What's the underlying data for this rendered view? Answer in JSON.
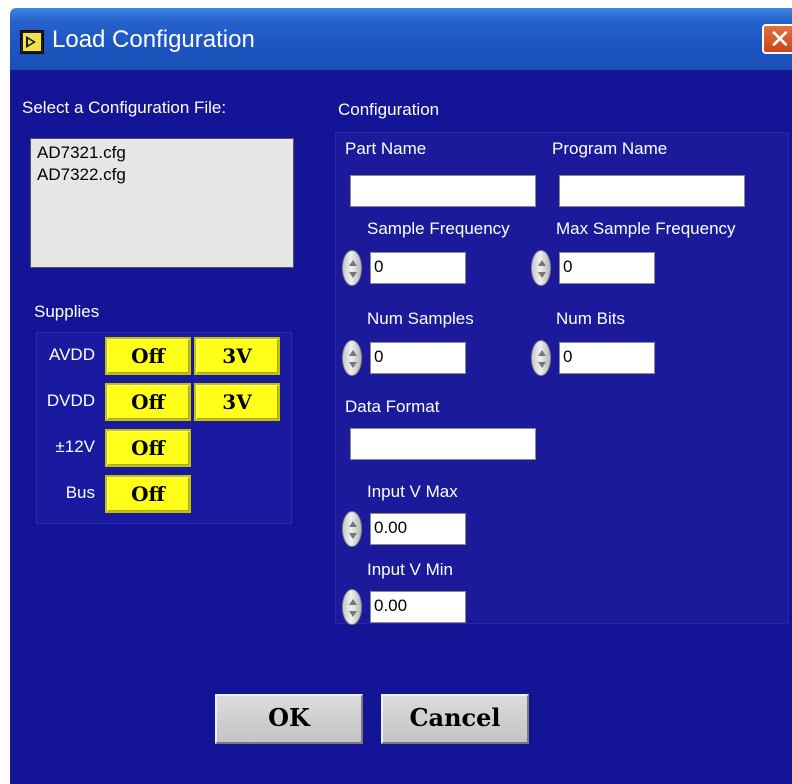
{
  "window": {
    "title": "Load Configuration",
    "close_glyph": "✕"
  },
  "file_select": {
    "label": "Select a Configuration File:",
    "files": [
      "AD7321.cfg",
      "AD7322.cfg"
    ]
  },
  "supplies": {
    "label": "Supplies",
    "rows": [
      {
        "name": "AVDD",
        "state": "Off",
        "voltage": "3V"
      },
      {
        "name": "DVDD",
        "state": "Off",
        "voltage": "3V"
      },
      {
        "name": "±12V",
        "state": "Off"
      },
      {
        "name": "Bus",
        "state": "Off"
      }
    ],
    "button_color": "#ffff19"
  },
  "config": {
    "label": "Configuration",
    "part_name": {
      "label": "Part Name",
      "value": ""
    },
    "program_name": {
      "label": "Program Name",
      "value": ""
    },
    "sample_frequency": {
      "label": "Sample Frequency",
      "value": "0"
    },
    "max_sample_frequency": {
      "label": "Max Sample Frequency",
      "value": "0"
    },
    "num_samples": {
      "label": "Num Samples",
      "value": "0"
    },
    "num_bits": {
      "label": "Num Bits",
      "value": "0"
    },
    "data_format": {
      "label": "Data Format",
      "value": ""
    },
    "input_v_max": {
      "label": "Input V Max",
      "value": "0.00"
    },
    "input_v_min": {
      "label": "Input V Min",
      "value": "0.00"
    }
  },
  "buttons": {
    "ok": "OK",
    "cancel": "Cancel"
  },
  "colors": {
    "background": "#141496",
    "title_bar": "#2763cc",
    "close_button": "#d9572c"
  }
}
